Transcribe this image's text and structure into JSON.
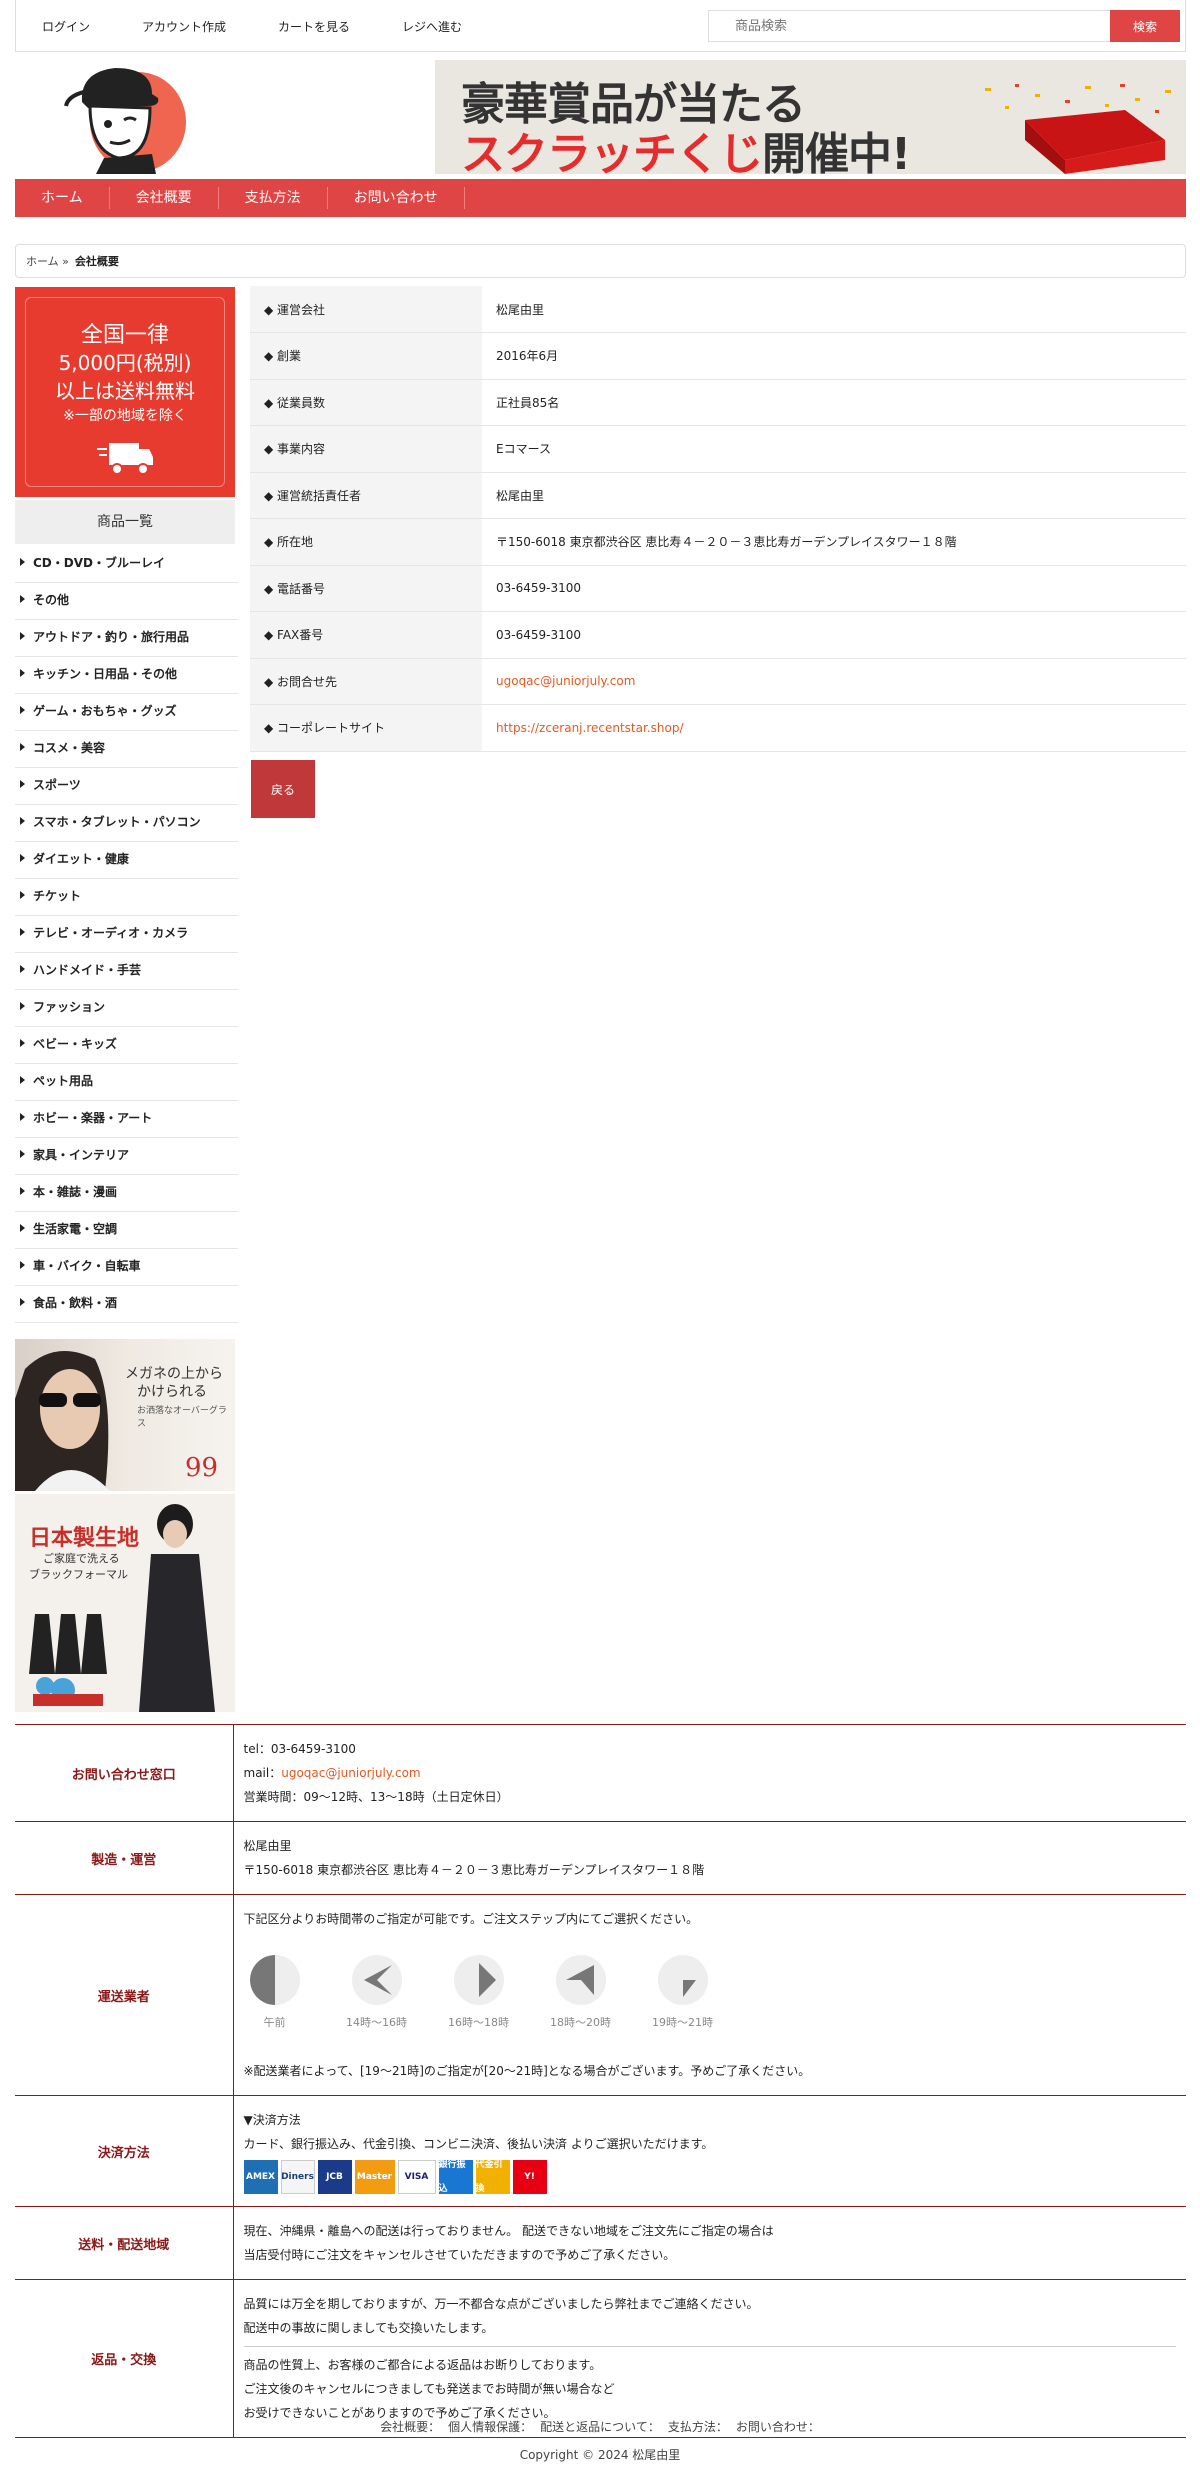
{
  "toplinks": [
    "ログイン",
    "アカウント作成",
    "カートを見る",
    "レジへ進む"
  ],
  "search": {
    "placeholder": "商品検索",
    "button": "検索"
  },
  "banner": {
    "line1": "豪華賞品が当たる",
    "line2_red": "スクラッチくじ",
    "line2_black": "開催中!"
  },
  "nav": [
    "ホーム",
    "会社概要",
    "支払方法",
    "お問い合わせ"
  ],
  "breadcrumb": {
    "home": "ホーム »",
    "current": "会社概要"
  },
  "promo": {
    "line1": "全国一律",
    "line2": "5,000円(税別)",
    "line3": "以上は送料無料",
    "line4": "※一部の地域を除く"
  },
  "category_title": "商品一覧",
  "categories": [
    "CD・DVD・ブルーレイ",
    "その他",
    "アウトドア・釣り・旅行用品",
    "キッチン・日用品・その他",
    "ゲーム・おもちゃ・グッズ",
    "コスメ・美容",
    "スポーツ",
    "スマホ・タブレット・パソコン",
    "ダイエット・健康",
    "チケット",
    "テレビ・オーディオ・カメラ",
    "ハンドメイド・手芸",
    "ファッション",
    "ベビー・キッズ",
    "ペット用品",
    "ホビー・楽器・アート",
    "家具・インテリア",
    "本・雑誌・漫画",
    "生活家電・空調",
    "車・バイク・自転車",
    "食品・飲料・酒"
  ],
  "ad1": {
    "line1": "メガネの上から",
    "line2": "かけられる",
    "line3": "お洒落なオーバーグラス",
    "price": "99"
  },
  "ad2": {
    "line1": "日本製生地",
    "line2": "ご家庭で洗える",
    "line3": "ブラックフォーマル"
  },
  "company": [
    {
      "key": "◆ 運営会社",
      "value": "松尾由里"
    },
    {
      "key": "◆ 創業",
      "value": "2016年6月"
    },
    {
      "key": "◆ 従業員数",
      "value": "正社員85名"
    },
    {
      "key": "◆ 事業内容",
      "value": "Eコマース"
    },
    {
      "key": "◆ 運営統括責任者",
      "value": "松尾由里"
    },
    {
      "key": "◆ 所在地",
      "value": "〒150-6018 東京都渋谷区 恵比寿４－２０－３恵比寿ガーデンプレイスタワー１８階"
    },
    {
      "key": "◆ 電話番号",
      "value": "03-6459-3100"
    },
    {
      "key": "◆ FAX番号",
      "value": "03-6459-3100"
    },
    {
      "key": "◆ お問合せ先",
      "value": "ugoqac@juniorjuly.com",
      "link": true
    },
    {
      "key": "◆ コーポレートサイト",
      "value": "https://zceranj.recentstar.shop/",
      "link": true
    }
  ],
  "back_button": "戻る",
  "footer_info": {
    "contact": {
      "head": "お問い合わせ窓口",
      "tel": "tel：03-6459-3100",
      "mail_label": "mail：",
      "mail": "ugoqac@juniorjuly.com",
      "hours": "営業時間：09〜12時、13〜18時（土日定休日）"
    },
    "maker": {
      "head": "製造・運営",
      "name": "松尾由里",
      "address": "〒150-6018 東京都渋谷区 恵比寿４－２０－３恵比寿ガーデンプレイスタワー１８階"
    },
    "delivery": {
      "head": "運送業者",
      "intro": "下記区分よりお時間帯のご指定が可能です。ご注文ステップ内にてご選択ください。",
      "slots": [
        "午前",
        "14時〜16時",
        "16時〜18時",
        "18時〜20時",
        "19時〜21時"
      ],
      "note": "※配送業者によって、[19〜21時]のご指定が[20〜21時]となる場合がございます。予めご了承ください。"
    },
    "payment": {
      "head": "決済方法",
      "title": "▼決済方法",
      "desc": "カード、銀行振込み、代金引換、コンビニ決済、後払い決済 よりご選択いただけます。",
      "cards": [
        "AMEX",
        "Diners",
        "JCB",
        "Master",
        "VISA",
        "銀行振込",
        "代金引換",
        "Y!"
      ]
    },
    "shipping": {
      "head": "送料・配送地域",
      "line1": "現在、沖縄県・離島への配送は行っておりません。 配送できない地域をご注文先にご指定の場合は",
      "line2": "当店受付時にご注文をキャンセルさせていただきますので予めご了承ください。"
    },
    "returns": {
      "head": "返品・交換",
      "line1": "品質には万全を期しておりますが、万一不都合な点がございましたら弊社までご連絡ください。",
      "line2": "配送中の事故に関しましても交換いたします。",
      "line3": "商品の性質上、お客様のご都合による返品はお断りしております。",
      "line4": "ご注文後のキャンセルにつきましても発送までお時間が無い場合など",
      "line5": "お受けできないことがありますので予めご了承ください。"
    }
  },
  "footer_links": [
    "会社概要：",
    "個人情報保護：",
    "配送と返品について：",
    "支払方法：",
    "お問い合わせ："
  ],
  "copyright": "Copyright © 2024 松尾由里"
}
